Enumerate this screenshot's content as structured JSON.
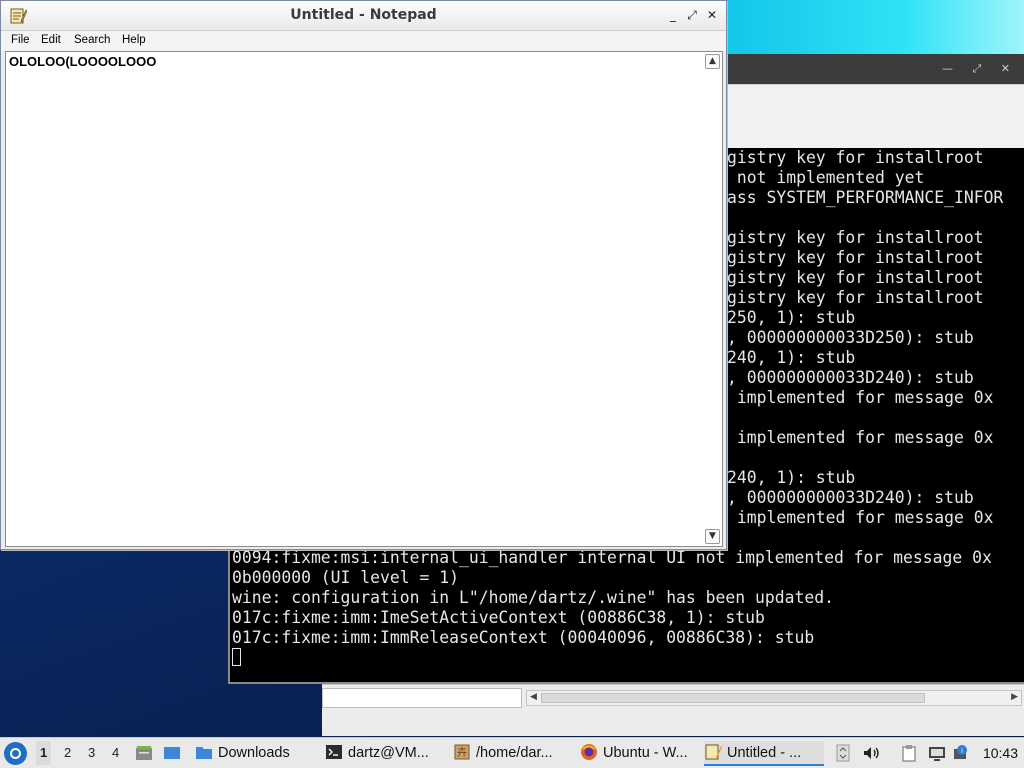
{
  "notepad": {
    "title": "Untitled - Notepad",
    "menu": [
      "File",
      "Edit",
      "Search",
      "Help"
    ],
    "content": "OLOLOO(LOOOOLOOO",
    "controls": {
      "minimize": "_",
      "maximize": "⤢",
      "close": "✕"
    }
  },
  "terminal": {
    "lines": [
      "gistry key for installroot",
      " not implemented yet",
      "ass SYSTEM_PERFORMANCE_INFOR",
      "",
      "gistry key for installroot",
      "gistry key for installroot",
      "gistry key for installroot",
      "gistry key for installroot",
      "250, 1): stub",
      ", 000000000033D250): stub",
      "240, 1): stub",
      ", 000000000033D240): stub",
      " implemented for message 0x",
      "",
      " implemented for message 0x",
      "",
      "240, 1): stub",
      ", 000000000033D240): stub",
      " implemented for message 0x",
      "",
      "0094:fixme:msi:internal_ui_handler internal UI not implemented for message 0x",
      "0b000000 (UI level = 1)",
      "wine: configuration in L\"/home/dartz/.wine\" has been updated.",
      "017c:fixme:imm:ImeSetActiveContext (00886C38, 1): stub",
      "017c:fixme:imm:ImmReleaseContext (00040096, 00886C38): stub"
    ]
  },
  "taskbar": {
    "workspaces": [
      "1",
      "2",
      "3",
      "4"
    ],
    "active_workspace": "1",
    "tasks": [
      {
        "label": "Downloads",
        "icon": "folder-icon"
      },
      {
        "label": "dartz@VM...",
        "icon": "terminal-icon"
      },
      {
        "label": "/home/dar...",
        "icon": "wine-icon"
      },
      {
        "label": "Ubuntu - W...",
        "icon": "firefox-icon"
      },
      {
        "label": "Untitled - ...",
        "icon": "notepad-icon"
      }
    ],
    "clock": "10:43"
  },
  "colors": {
    "accent": "#2a7fd4",
    "terminal_bg": "#000000",
    "terminal_fg": "#e6e6e6"
  }
}
